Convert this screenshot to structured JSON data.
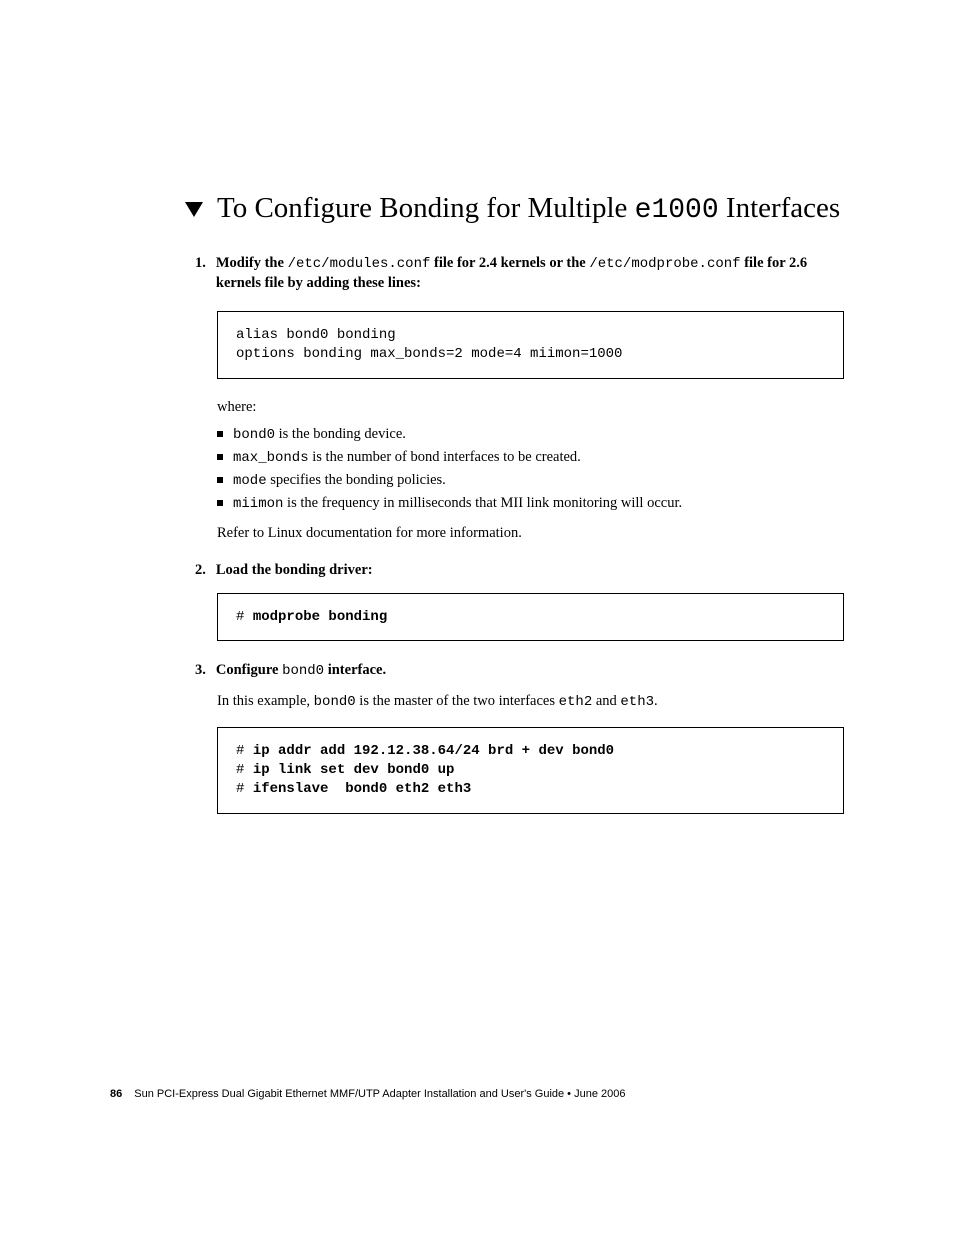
{
  "heading": {
    "prefix": "To Configure Bonding for Multiple ",
    "mono": "e1000",
    "suffix": " Interfaces"
  },
  "step1": {
    "num": "1.",
    "t1": "Modify the ",
    "file1": "/etc/modules.conf",
    "t2": " file for 2.4 kernels or the ",
    "file2": "/etc/modprobe.conf",
    "t3": " file for 2.6 kernels file by adding these lines:"
  },
  "code1": "alias bond0 bonding\noptions bonding max_bonds=2 mode=4 miimon=1000",
  "where": "where:",
  "bullets": [
    {
      "code": "bond0",
      "text": " is the bonding device."
    },
    {
      "code": "max_bonds",
      "text": " is the number of bond interfaces to be created."
    },
    {
      "code": "mode",
      "text": " specifies the bonding policies."
    },
    {
      "code": "miimon",
      "text": " is the frequency in milliseconds that MII link monitoring will occur."
    }
  ],
  "refer": "Refer to Linux documentation for more information.",
  "step2": {
    "num": "2.",
    "text": "Load the bonding driver:"
  },
  "code2": {
    "prompt": "# ",
    "cmd": "modprobe bonding"
  },
  "step3": {
    "num": "3.",
    "t1": "Configure ",
    "code": "bond0",
    "t2": " interface."
  },
  "example": {
    "t1": "In this example, ",
    "c1": "bond0",
    "t2": " is the master of the two interfaces ",
    "c2": "eth2",
    "t3": " and ",
    "c3": "eth3",
    "t4": "."
  },
  "code3": [
    {
      "prompt": "# ",
      "cmd": "ip addr add 192.12.38.64/24 brd + dev bond0"
    },
    {
      "prompt": "# ",
      "cmd": "ip link set dev bond0 up"
    },
    {
      "prompt": "# ",
      "cmd": "ifenslave  bond0 eth2 eth3"
    }
  ],
  "footer": {
    "page": "86",
    "title": "Sun PCI-Express Dual Gigabit Ethernet MMF/UTP Adapter Installation and User's Guide  •  June 2006"
  }
}
